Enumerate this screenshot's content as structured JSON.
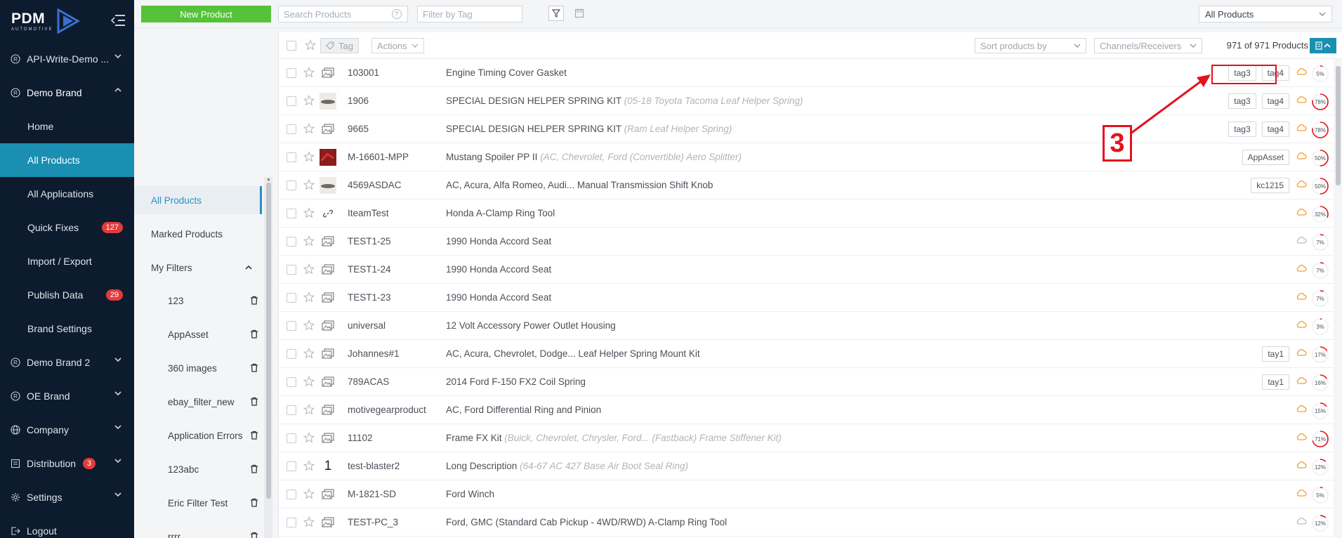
{
  "brand": {
    "logo_text": "PDM",
    "logo_sub": "AUTOMOTIVE"
  },
  "sidebar": {
    "items": [
      {
        "label": "API-Write-Demo ...",
        "icon": "registered-icon",
        "chevron": "down"
      },
      {
        "label": "Demo Brand",
        "icon": "registered-icon",
        "chevron": "up"
      },
      {
        "label": "Demo Brand 2",
        "icon": "registered-icon",
        "chevron": "down"
      },
      {
        "label": "OE Brand",
        "icon": "registered-icon",
        "chevron": "down"
      },
      {
        "label": "Company",
        "icon": "globe-icon",
        "chevron": "down"
      },
      {
        "label": "Distribution",
        "icon": "distribution-icon",
        "badge": "3",
        "chevron": "down"
      },
      {
        "label": "Settings",
        "icon": "gear-icon",
        "chevron": "down"
      },
      {
        "label": "Logout",
        "icon": "logout-icon"
      }
    ],
    "sub_items": [
      {
        "label": "Home"
      },
      {
        "label": "All Products",
        "active": true
      },
      {
        "label": "All Applications"
      },
      {
        "label": "Quick Fixes",
        "badge": "127"
      },
      {
        "label": "Import / Export"
      },
      {
        "label": "Publish Data",
        "badge": "29"
      },
      {
        "label": "Brand Settings"
      }
    ]
  },
  "topbar": {
    "new_product": "New Product",
    "search_placeholder": "Search Products",
    "tag_placeholder": "Filter by Tag",
    "product_scope": "All Products"
  },
  "filters": {
    "items": [
      {
        "label": "All Products",
        "active": true
      },
      {
        "label": "Marked Products"
      },
      {
        "label": "My Filters"
      }
    ],
    "saved": [
      "123",
      "AppAsset",
      "360 images",
      "ebay_filter_new",
      "Application Errors",
      "123abc",
      "Eric Filter Test",
      "rrrr"
    ]
  },
  "list_toolbar": {
    "tag_label": "Tag",
    "actions_label": "Actions",
    "sort_placeholder": "Sort products by",
    "channels_placeholder": "Channels/Receivers",
    "count": "971 of 971 Products"
  },
  "products": [
    {
      "sku": "103001",
      "name": "Engine Timing Cover Gasket",
      "desc": "",
      "tags": [
        "tag3",
        "tag4"
      ],
      "thumb": "image-placeholder-icon",
      "cloud": "orange",
      "pct": 5
    },
    {
      "sku": "1906",
      "name": "SPECIAL DESIGN HELPER SPRING KIT",
      "desc": "(05-18 Toyota Tacoma Leaf Helper Spring)",
      "tags": [
        "tag3",
        "tag4"
      ],
      "thumb": "product-photo",
      "cloud": "orange",
      "pct": 78
    },
    {
      "sku": "9665",
      "name": "SPECIAL DESIGN HELPER SPRING KIT",
      "desc": "(Ram Leaf Helper Spring)",
      "tags": [
        "tag3",
        "tag4"
      ],
      "thumb": "image-placeholder-icon",
      "cloud": "orange",
      "pct": 78
    },
    {
      "sku": "M-16601-MPP",
      "name": "Mustang Spoiler PP II",
      "desc": "(AC, Chevrolet, Ford (Convertible) Aero Splitter)",
      "tags": [
        "AppAsset"
      ],
      "thumb": "product-photo-red",
      "cloud": "orange",
      "pct": 50
    },
    {
      "sku": "4569ASDAC",
      "name": "AC, Acura, Alfa Romeo, Audi... Manual Transmission Shift Knob",
      "desc": "",
      "tags": [
        "kc1215"
      ],
      "thumb": "product-photo",
      "cloud": "orange",
      "pct": 50
    },
    {
      "sku": "IteamTest",
      "name": "Honda A-Clamp Ring Tool",
      "desc": "",
      "tags": [],
      "thumb": "link-icon",
      "cloud": "orange",
      "pct": 32
    },
    {
      "sku": "TEST1-25",
      "name": "1990 Honda Accord Seat",
      "desc": "",
      "tags": [],
      "thumb": "image-placeholder-icon",
      "cloud": "gray",
      "pct": 7
    },
    {
      "sku": "TEST1-24",
      "name": "1990 Honda Accord Seat",
      "desc": "",
      "tags": [],
      "thumb": "image-placeholder-icon",
      "cloud": "orange",
      "pct": 7
    },
    {
      "sku": "TEST1-23",
      "name": "1990 Honda Accord Seat",
      "desc": "",
      "tags": [],
      "thumb": "image-placeholder-icon",
      "cloud": "orange",
      "pct": 7
    },
    {
      "sku": "universal",
      "name": "12 Volt Accessory Power Outlet Housing",
      "desc": "",
      "tags": [],
      "thumb": "image-placeholder-icon",
      "cloud": "orange",
      "pct": 3
    },
    {
      "sku": "Johannes#1",
      "name": "AC, Acura, Chevrolet, Dodge... Leaf Helper Spring Mount Kit",
      "desc": "",
      "tags": [
        "tay1"
      ],
      "thumb": "image-placeholder-icon",
      "cloud": "orange",
      "pct": 17
    },
    {
      "sku": "789ACAS",
      "name": "2014 Ford F-150 FX2 Coil Spring",
      "desc": "",
      "tags": [
        "tay1"
      ],
      "thumb": "image-placeholder-icon",
      "cloud": "orange",
      "pct": 16
    },
    {
      "sku": "motivegearproduct",
      "name": "AC, Ford Differential Ring and Pinion",
      "desc": "",
      "tags": [],
      "thumb": "image-placeholder-icon",
      "cloud": "orange",
      "pct": 15
    },
    {
      "sku": "11102",
      "name": "Frame FX Kit",
      "desc": "(Buick, Chevrolet, Chrysler, Ford... (Fastback) Frame Stiffener Kit)",
      "tags": [],
      "thumb": "image-placeholder-icon",
      "cloud": "orange",
      "pct": 71
    },
    {
      "sku": "test-blaster2",
      "name": "Long Description",
      "desc": "(64-67 AC 427 Base Air Boot Seal Ring)",
      "tags": [],
      "thumb": "number-one",
      "thumb_text": "1",
      "cloud": "orange",
      "pct": 12
    },
    {
      "sku": "M-1821-SD",
      "name": "Ford Winch",
      "desc": "",
      "tags": [],
      "thumb": "image-placeholder-icon",
      "cloud": "orange",
      "pct": 5
    },
    {
      "sku": "TEST-PC_3",
      "name": "Ford, GMC (Standard Cab Pickup - 4WD/RWD) A-Clamp Ring Tool",
      "desc": "",
      "tags": [],
      "thumb": "image-placeholder-icon",
      "cloud": "gray",
      "pct": 12
    }
  ],
  "annotation": {
    "label": "3",
    "color": "#e3121d"
  },
  "colors": {
    "sidebar": "#0c1b2e",
    "active": "#1b8fb2",
    "new_button": "#56c23a",
    "badge": "#e23b3b",
    "cloud": "#f0a030",
    "progress": "#e3121d"
  }
}
